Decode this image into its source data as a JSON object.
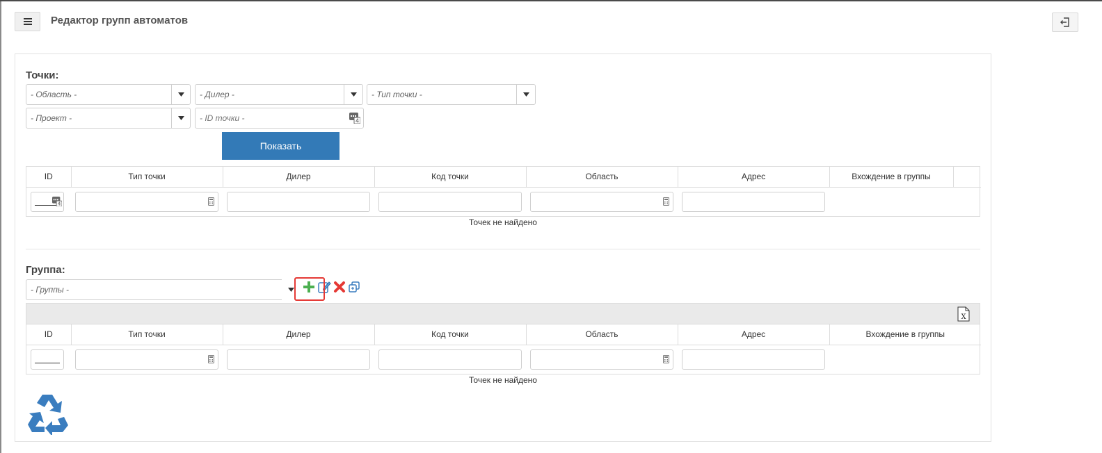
{
  "header": {
    "title": "Редактор групп автоматов",
    "menu_icon": "hamburger-icon",
    "logout_icon": "logout-icon"
  },
  "points": {
    "title": "Точки:",
    "filters": {
      "region_placeholder": "- Область -",
      "dealer_placeholder": "- Дилер -",
      "point_type_placeholder": "- Тип точки -",
      "project_placeholder": "- Проект -",
      "point_id_placeholder": "- ID точки -"
    },
    "show_button": "Показать",
    "table": {
      "columns": [
        "ID",
        "Тип точки",
        "Дилер",
        "Код точки",
        "Область",
        "Адрес",
        "Вхождение в группы"
      ]
    },
    "empty_message": "Точек не найдено"
  },
  "group": {
    "title": "Группа:",
    "group_placeholder": "- Группы -",
    "tools": [
      "add-icon",
      "edit-icon",
      "delete-icon",
      "copy-icon"
    ],
    "table": {
      "columns": [
        "ID",
        "Тип точки",
        "Дилер",
        "Код точки",
        "Область",
        "Адрес",
        "Вхождение в группы"
      ]
    },
    "empty_message": "Точек не найдено"
  },
  "colors": {
    "primary": "#337ab7",
    "add": "#4caf50",
    "delete": "#e53935",
    "highlight": "#e53935"
  }
}
